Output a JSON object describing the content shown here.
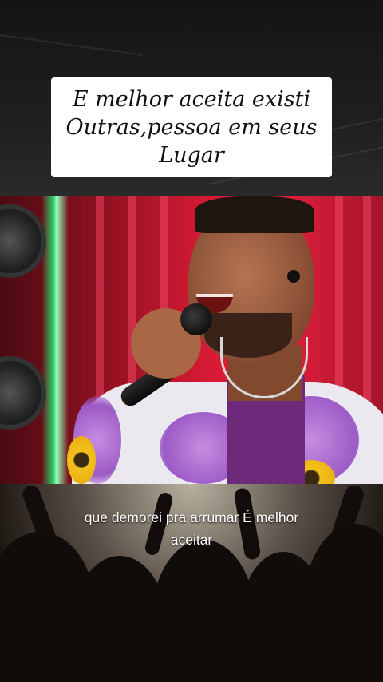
{
  "caption": {
    "lines": [
      "E melhor aceita existi",
      "Outras,pessoa em seus",
      "Lugar"
    ]
  },
  "subtitle": {
    "lines": [
      "que demorei pra arrumar É melhor",
      "aceitar"
    ]
  },
  "colors": {
    "caption_background": "#ffffff",
    "caption_text": "#111111",
    "stage_red": "#e01f3c",
    "stage_green": "#28d26a",
    "subtitle_text": "#ffffff"
  }
}
